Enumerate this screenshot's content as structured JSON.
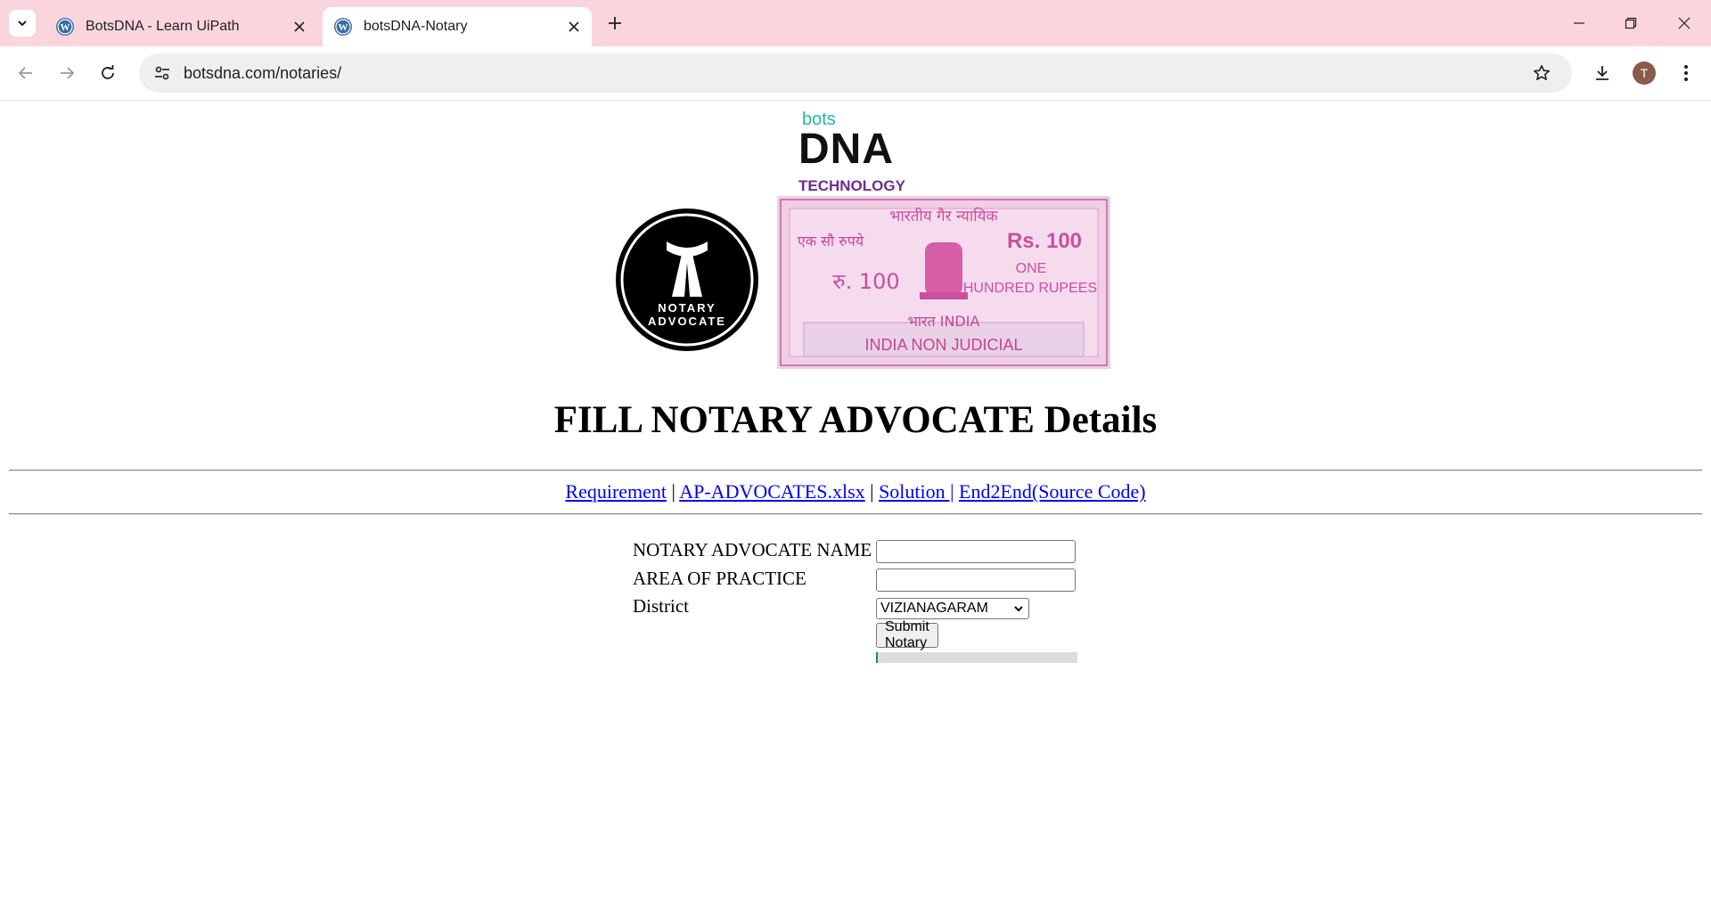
{
  "browser": {
    "tabs": [
      {
        "title": "BotsDNA - Learn UiPath",
        "active": false
      },
      {
        "title": "botsDNA-Notary",
        "active": true
      }
    ],
    "url_host": "botsdna.com",
    "url_path": "/notaries/",
    "profile_initial": "T",
    "icons": {
      "tab_menu": "chevron-down-icon",
      "favicon": "wordpress-icon",
      "close": "close-icon",
      "new_tab": "plus-icon",
      "minimize": "minimize-icon",
      "restore": "restore-icon",
      "window_close": "window-close-icon",
      "back": "back-arrow-icon",
      "forward": "forward-arrow-icon",
      "reload": "reload-icon",
      "site_info": "site-settings-icon",
      "bookmark": "star-icon",
      "download": "download-icon",
      "menu": "kebab-menu-icon"
    },
    "colors": {
      "tabstrip": "#fbd5de",
      "accent_teal": "#24b5a3",
      "purple": "#6b2d91"
    }
  },
  "page": {
    "logo": {
      "bots": "bots",
      "dna": "DNA",
      "tech": "TECHNOLOGY"
    },
    "badge": {
      "line1": "NOTARY",
      "line2": "ADVOCATE"
    },
    "stamp": {
      "hindi_top": "भारतीय गैर न्यायिक",
      "hindi_value": "एक सौ रुपये",
      "rs_value": "Rs. 100",
      "ru_value": "रु. 100",
      "one": "ONE",
      "hundred_rupees": "HUNDRED RUPEES",
      "bharat_india": "भारत INDIA",
      "non_judicial": "INDIA NON JUDICIAL"
    },
    "title": "FILL NOTARY ADVOCATE Details",
    "links": {
      "requirement": "Requirement",
      "sep1": " | ",
      "xlsx": "AP-ADVOCATES.xlsx",
      "sep2": " | ",
      "solution": "Solution |",
      "sep3": " ",
      "source": "End2End(Source Code)"
    },
    "form": {
      "name_label": "NOTARY ADVOCATE NAME",
      "name_value": "",
      "area_label": "AREA OF PRACTICE",
      "area_value": "",
      "district_label": "District",
      "district_value": "VIZIANAGARAM",
      "submit_label": "Submit Notary",
      "progress": 0.01
    }
  }
}
